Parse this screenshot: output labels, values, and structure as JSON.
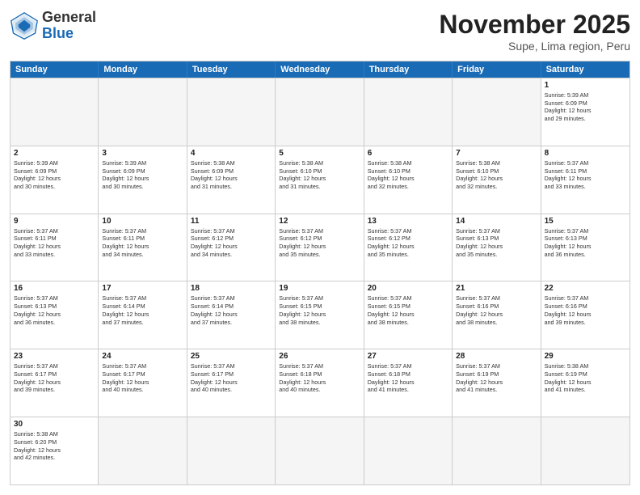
{
  "header": {
    "logo_general": "General",
    "logo_blue": "Blue",
    "month": "November 2025",
    "location": "Supe, Lima region, Peru"
  },
  "days_of_week": [
    "Sunday",
    "Monday",
    "Tuesday",
    "Wednesday",
    "Thursday",
    "Friday",
    "Saturday"
  ],
  "weeks": [
    [
      {
        "day": "",
        "info": ""
      },
      {
        "day": "",
        "info": ""
      },
      {
        "day": "",
        "info": ""
      },
      {
        "day": "",
        "info": ""
      },
      {
        "day": "",
        "info": ""
      },
      {
        "day": "",
        "info": ""
      },
      {
        "day": "1",
        "info": "Sunrise: 5:39 AM\nSunset: 6:09 PM\nDaylight: 12 hours\nand 29 minutes."
      }
    ],
    [
      {
        "day": "2",
        "info": "Sunrise: 5:39 AM\nSunset: 6:09 PM\nDaylight: 12 hours\nand 30 minutes."
      },
      {
        "day": "3",
        "info": "Sunrise: 5:39 AM\nSunset: 6:09 PM\nDaylight: 12 hours\nand 30 minutes."
      },
      {
        "day": "4",
        "info": "Sunrise: 5:38 AM\nSunset: 6:09 PM\nDaylight: 12 hours\nand 31 minutes."
      },
      {
        "day": "5",
        "info": "Sunrise: 5:38 AM\nSunset: 6:10 PM\nDaylight: 12 hours\nand 31 minutes."
      },
      {
        "day": "6",
        "info": "Sunrise: 5:38 AM\nSunset: 6:10 PM\nDaylight: 12 hours\nand 32 minutes."
      },
      {
        "day": "7",
        "info": "Sunrise: 5:38 AM\nSunset: 6:10 PM\nDaylight: 12 hours\nand 32 minutes."
      },
      {
        "day": "8",
        "info": "Sunrise: 5:37 AM\nSunset: 6:11 PM\nDaylight: 12 hours\nand 33 minutes."
      }
    ],
    [
      {
        "day": "9",
        "info": "Sunrise: 5:37 AM\nSunset: 6:11 PM\nDaylight: 12 hours\nand 33 minutes."
      },
      {
        "day": "10",
        "info": "Sunrise: 5:37 AM\nSunset: 6:11 PM\nDaylight: 12 hours\nand 34 minutes."
      },
      {
        "day": "11",
        "info": "Sunrise: 5:37 AM\nSunset: 6:12 PM\nDaylight: 12 hours\nand 34 minutes."
      },
      {
        "day": "12",
        "info": "Sunrise: 5:37 AM\nSunset: 6:12 PM\nDaylight: 12 hours\nand 35 minutes."
      },
      {
        "day": "13",
        "info": "Sunrise: 5:37 AM\nSunset: 6:12 PM\nDaylight: 12 hours\nand 35 minutes."
      },
      {
        "day": "14",
        "info": "Sunrise: 5:37 AM\nSunset: 6:13 PM\nDaylight: 12 hours\nand 35 minutes."
      },
      {
        "day": "15",
        "info": "Sunrise: 5:37 AM\nSunset: 6:13 PM\nDaylight: 12 hours\nand 36 minutes."
      }
    ],
    [
      {
        "day": "16",
        "info": "Sunrise: 5:37 AM\nSunset: 6:13 PM\nDaylight: 12 hours\nand 36 minutes."
      },
      {
        "day": "17",
        "info": "Sunrise: 5:37 AM\nSunset: 6:14 PM\nDaylight: 12 hours\nand 37 minutes."
      },
      {
        "day": "18",
        "info": "Sunrise: 5:37 AM\nSunset: 6:14 PM\nDaylight: 12 hours\nand 37 minutes."
      },
      {
        "day": "19",
        "info": "Sunrise: 5:37 AM\nSunset: 6:15 PM\nDaylight: 12 hours\nand 38 minutes."
      },
      {
        "day": "20",
        "info": "Sunrise: 5:37 AM\nSunset: 6:15 PM\nDaylight: 12 hours\nand 38 minutes."
      },
      {
        "day": "21",
        "info": "Sunrise: 5:37 AM\nSunset: 6:16 PM\nDaylight: 12 hours\nand 38 minutes."
      },
      {
        "day": "22",
        "info": "Sunrise: 5:37 AM\nSunset: 6:16 PM\nDaylight: 12 hours\nand 39 minutes."
      }
    ],
    [
      {
        "day": "23",
        "info": "Sunrise: 5:37 AM\nSunset: 6:17 PM\nDaylight: 12 hours\nand 39 minutes."
      },
      {
        "day": "24",
        "info": "Sunrise: 5:37 AM\nSunset: 6:17 PM\nDaylight: 12 hours\nand 40 minutes."
      },
      {
        "day": "25",
        "info": "Sunrise: 5:37 AM\nSunset: 6:17 PM\nDaylight: 12 hours\nand 40 minutes."
      },
      {
        "day": "26",
        "info": "Sunrise: 5:37 AM\nSunset: 6:18 PM\nDaylight: 12 hours\nand 40 minutes."
      },
      {
        "day": "27",
        "info": "Sunrise: 5:37 AM\nSunset: 6:18 PM\nDaylight: 12 hours\nand 41 minutes."
      },
      {
        "day": "28",
        "info": "Sunrise: 5:37 AM\nSunset: 6:19 PM\nDaylight: 12 hours\nand 41 minutes."
      },
      {
        "day": "29",
        "info": "Sunrise: 5:38 AM\nSunset: 6:19 PM\nDaylight: 12 hours\nand 41 minutes."
      }
    ],
    [
      {
        "day": "30",
        "info": "Sunrise: 5:38 AM\nSunset: 6:20 PM\nDaylight: 12 hours\nand 42 minutes."
      },
      {
        "day": "",
        "info": ""
      },
      {
        "day": "",
        "info": ""
      },
      {
        "day": "",
        "info": ""
      },
      {
        "day": "",
        "info": ""
      },
      {
        "day": "",
        "info": ""
      },
      {
        "day": "",
        "info": ""
      }
    ]
  ]
}
